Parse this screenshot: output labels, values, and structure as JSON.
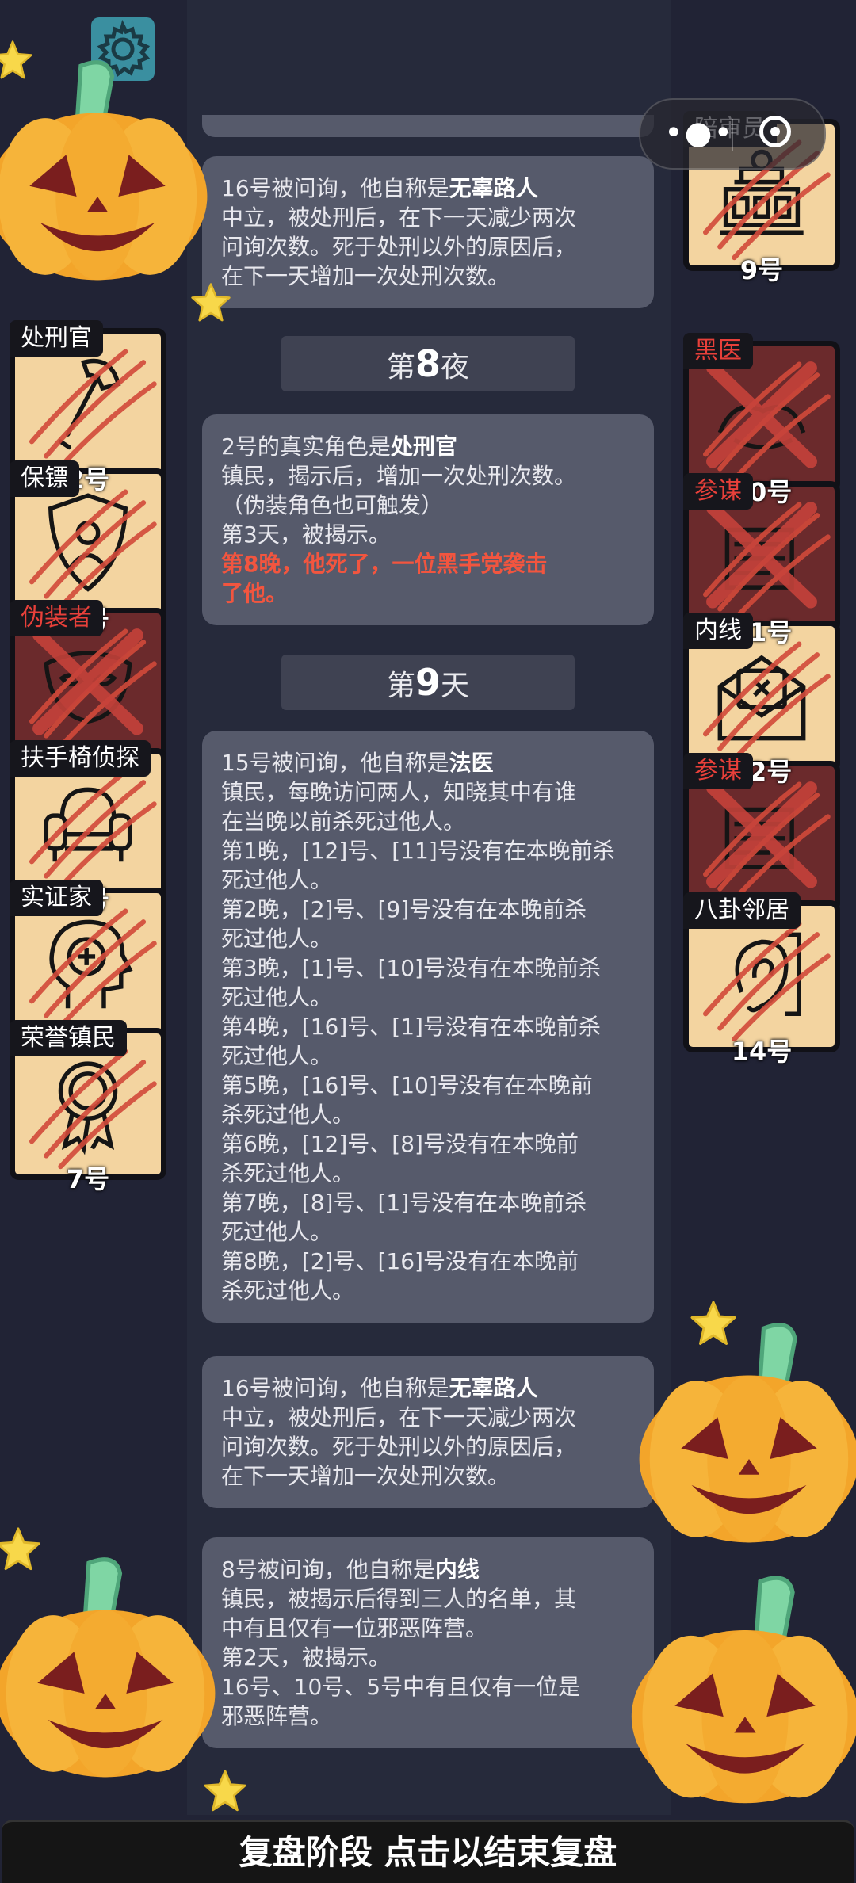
{
  "capsule": {
    "more_icon": "more-dots-icon",
    "close_icon": "close-circle-icon"
  },
  "settings": {
    "icon": "gear-icon"
  },
  "log": {
    "cards": [
      {
        "lines": [
          [
            "16号被问询，他自称是",
            "无辜路人"
          ],
          [
            "中立，被处刑后，在下一天减少两次"
          ],
          [
            "问询次数。死于处刑以外的原因后，"
          ],
          [
            "在下一天增加一次处刑次数。"
          ]
        ]
      },
      {
        "lines": [
          [
            "2号的真实角色是",
            "处刑官"
          ],
          [
            "镇民，揭示后，增加一次处刑次数。"
          ],
          [
            "（伪装角色也可触发）"
          ],
          [
            "第3天，被揭示。"
          ]
        ],
        "highlight": [
          "第8晚，他死了，一位黑手党袭击",
          "了他。"
        ]
      },
      {
        "lines": [
          [
            "15号被问询，他自称是",
            "法医"
          ],
          [
            "镇民，每晚访问两人，知晓其中有谁"
          ],
          [
            "在当晚以前杀死过他人。"
          ],
          [
            "第1晚，[12]号、[11]号没有在本晚前杀"
          ],
          [
            "死过他人。"
          ],
          [
            "第2晚，[2]号、[9]号没有在本晚前杀"
          ],
          [
            "死过他人。"
          ],
          [
            "第3晚，[1]号、[10]号没有在本晚前杀"
          ],
          [
            "死过他人。"
          ],
          [
            "第4晚，[16]号、[1]号没有在本晚前杀"
          ],
          [
            "死过他人。"
          ],
          [
            "第5晚，[16]号、[10]号没有在本晚前"
          ],
          [
            "杀死过他人。"
          ],
          [
            "第6晚，[12]号、[8]号没有在本晚前"
          ],
          [
            "杀死过他人。"
          ],
          [
            "第7晚，[8]号、[1]号没有在本晚前杀"
          ],
          [
            "死过他人。"
          ],
          [
            "第8晚，[2]号、[16]号没有在本晚前"
          ],
          [
            "杀死过他人。"
          ]
        ]
      },
      {
        "lines": [
          [
            "16号被问询，他自称是",
            "无辜路人"
          ],
          [
            "中立，被处刑后，在下一天减少两次"
          ],
          [
            "问询次数。死于处刑以外的原因后，"
          ],
          [
            "在下一天增加一次处刑次数。"
          ]
        ]
      },
      {
        "lines": [
          [
            "8号被问询，他自称是",
            "内线"
          ],
          [
            "镇民，被揭示后得到三人的名单，其"
          ],
          [
            "中有且仅有一位邪恶阵营。"
          ],
          [
            "第2天，被揭示。"
          ],
          [
            "16号、10号、5号中有且仅有一位是"
          ],
          [
            "邪恶阵营。"
          ]
        ]
      }
    ],
    "phases": [
      {
        "pre": "第",
        "num": "8",
        "post": "夜"
      },
      {
        "pre": "第",
        "num": "9",
        "post": "天"
      }
    ]
  },
  "players_left": [
    {
      "role": "处刑官",
      "number": "2号",
      "icon": "axe-hammer-icon",
      "dead": false,
      "role_color": "#ffffff"
    },
    {
      "role": "保镖",
      "number": "3号",
      "icon": "shield-person-icon",
      "dead": false,
      "role_color": "#ffffff"
    },
    {
      "role": "伪装者",
      "number": "4号",
      "icon": "mask-icon",
      "dead": true,
      "role_color": "#e8403a"
    },
    {
      "role": "扶手椅侦探",
      "number": "5号",
      "icon": "armchair-icon",
      "dead": false,
      "role_color": "#ffffff"
    },
    {
      "role": "实证家",
      "number": "6号",
      "icon": "head-plus-icon",
      "dead": false,
      "role_color": "#ffffff"
    },
    {
      "role": "荣誉镇民",
      "number": "7号",
      "icon": "medal-icon",
      "dead": false,
      "role_color": "#ffffff"
    }
  ],
  "players_right": [
    {
      "role": "陪审员",
      "number": "9号",
      "icon": "courthouse-icon",
      "dead": false,
      "role_color": "#ffffff"
    },
    {
      "role": "黑医",
      "number": "10号",
      "icon": "hands-icon",
      "dead": true,
      "role_color": "#e8403a"
    },
    {
      "role": "参谋",
      "number": "11号",
      "icon": "scroll-icon",
      "dead": true,
      "role_color": "#e8403a"
    },
    {
      "role": "内线",
      "number": "12号",
      "icon": "envelope-icon",
      "dead": false,
      "role_color": "#ffffff"
    },
    {
      "role": "参谋",
      "number": "13号",
      "icon": "scroll-icon",
      "dead": true,
      "role_color": "#e8403a"
    },
    {
      "role": "八卦邻居",
      "number": "14号",
      "icon": "ear-icon",
      "dead": false,
      "role_color": "#ffffff"
    }
  ],
  "footer": {
    "label": "复盘阶段 点击以结束复盘"
  },
  "decorations": {
    "pumpkin_icon": "pumpkin-icon",
    "star_icon": "star-icon"
  }
}
